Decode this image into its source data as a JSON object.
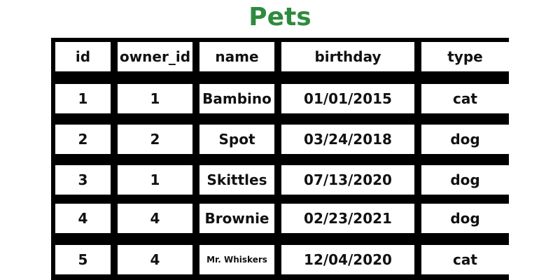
{
  "title": "Pets",
  "colors": {
    "title": "#2e8b3e",
    "table_border": "#000000",
    "cell_background": "#ffffff"
  },
  "table": {
    "headers": [
      "id",
      "owner_id",
      "name",
      "birthday",
      "type"
    ],
    "rows": [
      [
        "1",
        "1",
        "Bambino",
        "01/01/2015",
        "cat"
      ],
      [
        "2",
        "2",
        "Spot",
        "03/24/2018",
        "dog"
      ],
      [
        "3",
        "1",
        "Skittles",
        "07/13/2020",
        "dog"
      ],
      [
        "4",
        "4",
        "Brownie",
        "02/23/2021",
        "dog"
      ],
      [
        "5",
        "4",
        "Mr. Whiskers",
        "12/04/2020",
        "cat"
      ]
    ]
  }
}
